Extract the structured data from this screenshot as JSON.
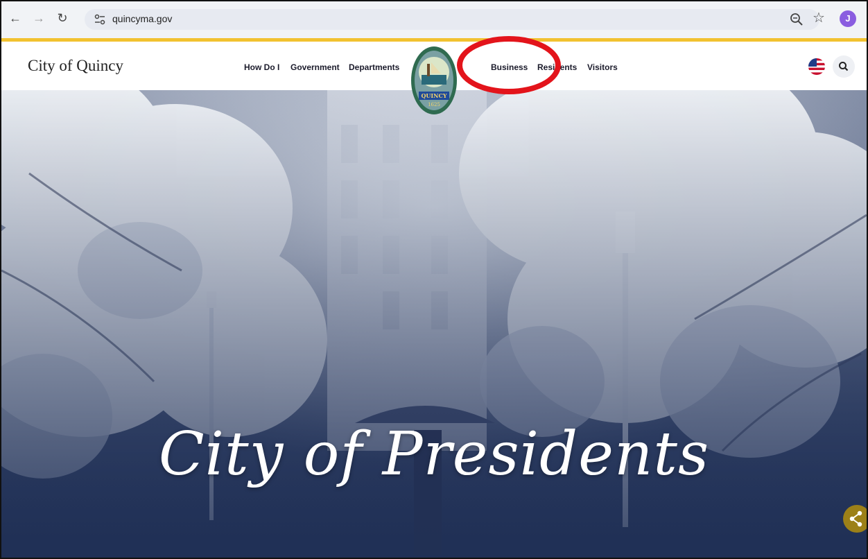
{
  "browser": {
    "url": "quincyma.gov",
    "avatar_letter": "J",
    "accent_color": "#f2c230"
  },
  "site": {
    "title": "City of Quincy",
    "nav": [
      "How Do I",
      "Government",
      "Departments",
      "Business",
      "Residents",
      "Visitors"
    ],
    "seal_text_top": "QUINCY",
    "seal_text_bottom": "1625"
  },
  "hero": {
    "headline": "City of Presidents"
  },
  "annotation": {
    "color": "#e3141b",
    "shape": "ellipse"
  }
}
